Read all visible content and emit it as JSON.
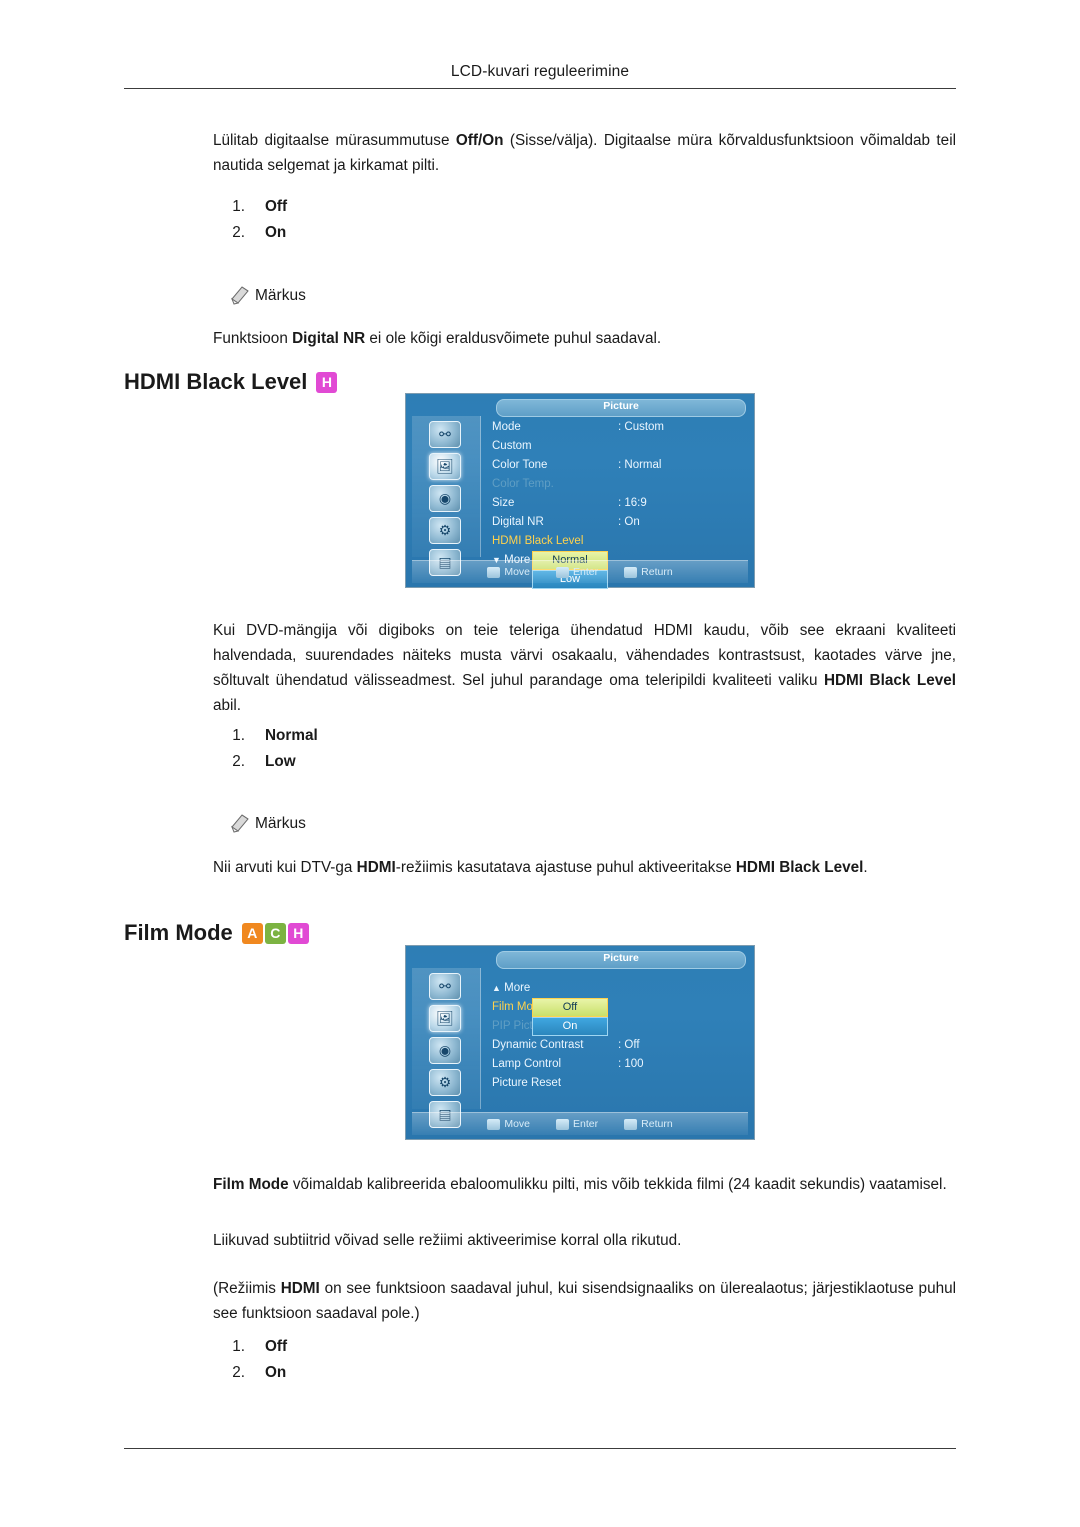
{
  "page": {
    "header": "LCD-kuvari reguleerimine"
  },
  "intro": {
    "text_1": "Lülitab digitaalse mürasummutuse ",
    "bold_1": "Off/On",
    "text_2": " (Sisse/välja). Digitaalse müra kõrvaldusfunktsioon võimaldab teil nautida selgemat ja kirkamat pilti.",
    "options": [
      {
        "num": "1.",
        "label": "Off"
      },
      {
        "num": "2.",
        "label": "On"
      }
    ],
    "note_label": "Märkus",
    "note_text_1": "Funktsioon ",
    "note_bold": "Digital NR",
    "note_text_2": " ei ole kõigi eraldusvõimete puhul saadaval."
  },
  "hdmi_black_level": {
    "title": "HDMI Black Level",
    "badges": [
      {
        "letter": "H",
        "color": "#e14ad4"
      }
    ],
    "osd": {
      "title": "Picture",
      "rows": [
        {
          "label": "Mode",
          "value": ": Custom",
          "state": "normal"
        },
        {
          "label": "Custom",
          "value": "",
          "state": "normal"
        },
        {
          "label": "Color Tone",
          "value": ": Normal",
          "state": "normal"
        },
        {
          "label": "Color Temp.",
          "value": "",
          "state": "dim"
        },
        {
          "label": "Size",
          "value": ": 16:9",
          "state": "normal"
        },
        {
          "label": "Digital NR",
          "value": ": On",
          "state": "normal"
        },
        {
          "label": "HDMI Black Level",
          "value": "",
          "state": "highlight"
        },
        {
          "label": "More",
          "value": "",
          "state": "normal"
        }
      ],
      "selected_value": "Normal",
      "second_value": "Low",
      "footer": [
        "Move",
        "Enter",
        "Return"
      ]
    },
    "paragraph": "Kui DVD-mängija või digiboks on teie teleriga ühendatud HDMI kaudu, võib see ekraani kvaliteeti halvendada, suurendades näiteks musta värvi osakaalu, vähendades kontrastsust, kaotades värve jne, sõltuvalt ühendatud välisseadmest. Sel juhul parandage oma teleripildi kvaliteeti valiku ",
    "paragraph_bold": "HDMI Black Level",
    "paragraph_tail": " abil.",
    "options": [
      {
        "num": "1.",
        "label": "Normal"
      },
      {
        "num": "2.",
        "label": "Low"
      }
    ],
    "note_label": "Märkus",
    "note_parts": {
      "t1": "Nii arvuti kui DTV-ga ",
      "b1": "HDMI",
      "t2": "-režiimis kasutatava ajastuse puhul aktiveeritakse ",
      "b2": "HDMI Black Level",
      "t3": "."
    }
  },
  "film_mode": {
    "title": "Film Mode",
    "badges": [
      {
        "letter": "A",
        "color": "#f0881f"
      },
      {
        "letter": "C",
        "color": "#7cb342"
      },
      {
        "letter": "H",
        "color": "#e14ad4"
      }
    ],
    "osd": {
      "title": "Picture",
      "rows": [
        {
          "label": "More",
          "value": "",
          "state": "normal"
        },
        {
          "label": "Film Mode",
          "value": "",
          "state": "highlight"
        },
        {
          "label": "PIP Picture",
          "value": "",
          "state": "dim"
        },
        {
          "label": "Dynamic Contrast",
          "value": ": Off",
          "state": "normal"
        },
        {
          "label": "Lamp Control",
          "value": ": 100",
          "state": "normal"
        },
        {
          "label": "Picture Reset",
          "value": "",
          "state": "normal"
        }
      ],
      "selected_value": "Off",
      "second_value": "On",
      "footer": [
        "Move",
        "Enter",
        "Return"
      ]
    },
    "paragraph_bold": "Film Mode",
    "paragraph_tail": " võimaldab kalibreerida ebaloomulikku pilti, mis võib tekkida filmi (24 kaadit sekundis) vaatamisel.",
    "paragraph_2": "Liikuvad subtiitrid võivad selle režiimi aktiveerimise korral olla rikutud.",
    "paragraph_3_parts": {
      "t1": "(Režiimis ",
      "b1": "HDMI",
      "t2": " on see funktsioon saadaval juhul, kui sisendsignaaliks on ülerealaotus; järjestiklaotuse puhul see funktsioon saadaval pole.)"
    },
    "options": [
      {
        "num": "1.",
        "label": "Off"
      },
      {
        "num": "2.",
        "label": "On"
      }
    ]
  }
}
